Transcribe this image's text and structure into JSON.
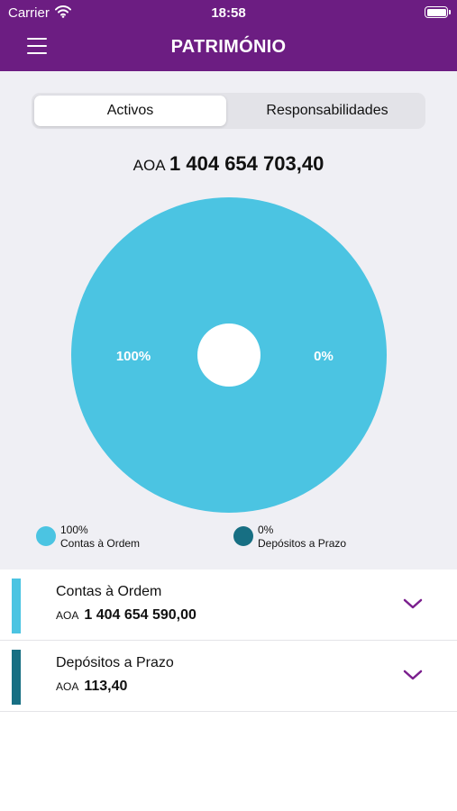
{
  "status_bar": {
    "carrier": "Carrier",
    "time": "18:58"
  },
  "header": {
    "title": "PATRIMÓNIO",
    "menu_icon": "hamburger-menu-icon"
  },
  "tabs": [
    {
      "label": "Activos",
      "selected": true
    },
    {
      "label": "Responsabilidades",
      "selected": false
    }
  ],
  "total": {
    "currency": "AOA",
    "amount": "1 404 654 703,40"
  },
  "chart_data": {
    "type": "pie",
    "categories": [
      "Contas à Ordem",
      "Depósitos a Prazo"
    ],
    "values": [
      100,
      0
    ],
    "labels": [
      "100%",
      "0%"
    ],
    "colors": [
      "#4bc4e2",
      "#176f83"
    ],
    "legend_placement": "bottom"
  },
  "legend": [
    {
      "percent": "100%",
      "label": "Contas à Ordem",
      "color": "#4bc4e2"
    },
    {
      "percent": "0%",
      "label": "Depósitos a Prazo",
      "color": "#176f83"
    }
  ],
  "accounts": [
    {
      "name": "Contas à Ordem",
      "currency": "AOA",
      "amount": "1 404 654 590,00",
      "color": "#4bc4e2"
    },
    {
      "name": "Depósitos a Prazo",
      "currency": "AOA",
      "amount": "113,40",
      "color": "#176f83"
    }
  ],
  "colors": {
    "brand": "#6c1d82",
    "chevron": "#7b1f8e",
    "background": "#efeff4"
  }
}
